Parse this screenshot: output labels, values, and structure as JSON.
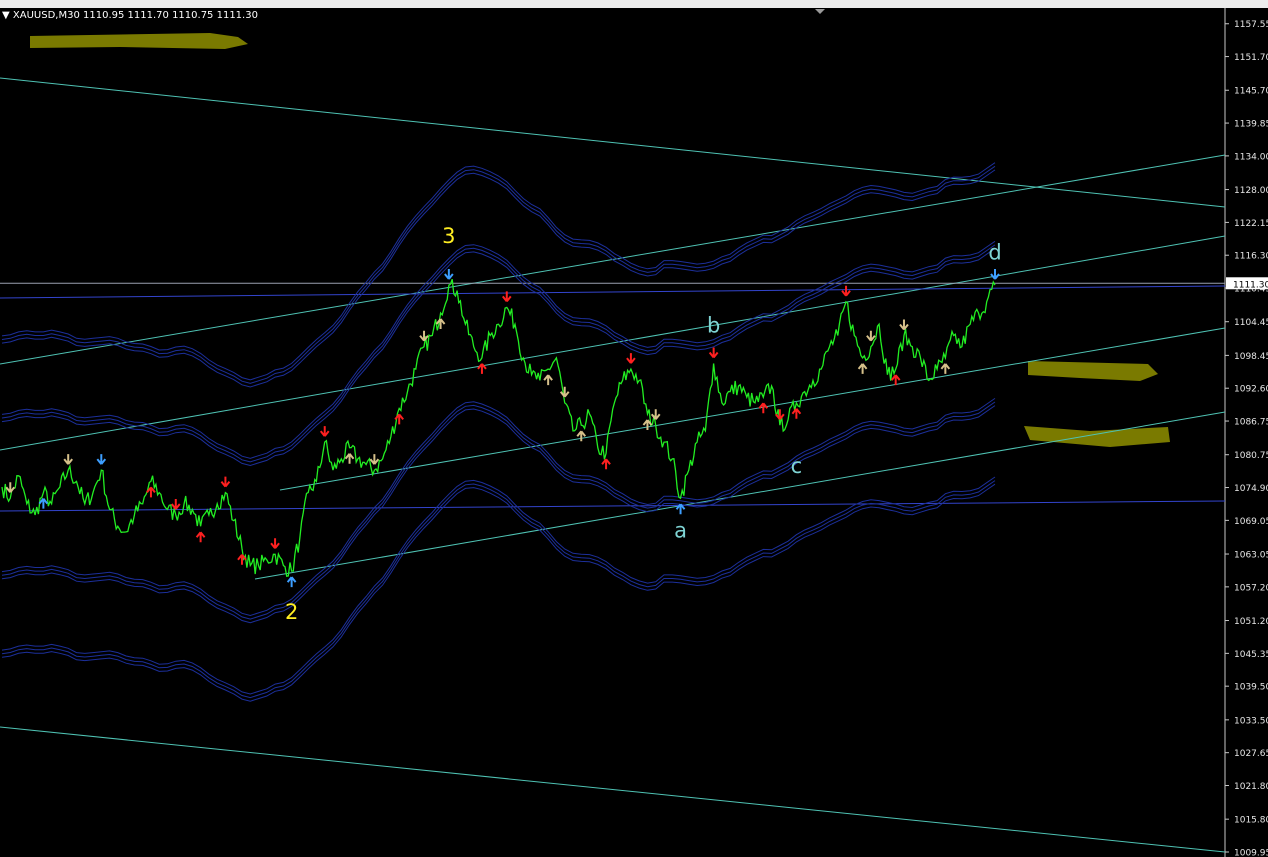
{
  "header": {
    "symbol": "XAUUSD,M30",
    "quote": "1110.95 1111.70 1110.75 1111.30"
  },
  "colors": {
    "background": "#000000",
    "price": "#22ee22",
    "band": "#1c2f9a",
    "channel": "#4fc3b4",
    "horizontal": "#3344cc",
    "arrow_up_blue": "#3d9eff",
    "arrow_down_red": "#ff2020",
    "arrow_beige": "#d6c08a",
    "wave_yellow": "#ffee22",
    "wave_cyan": "#7fd4d4",
    "highlight": "#7a7a00"
  },
  "chart_data": {
    "type": "line",
    "title": "",
    "ylim": [
      1009.95,
      1160.0
    ],
    "y_ticks": [
      "1157.55",
      "1151.70",
      "1145.70",
      "1139.85",
      "1134.00",
      "1128.00",
      "1122.15",
      "1116.30",
      "1110.45",
      "1104.45",
      "1098.45",
      "1092.60",
      "1086.75",
      "1080.75",
      "1074.90",
      "1069.05",
      "1063.05",
      "1057.20",
      "1051.20",
      "1045.35",
      "1039.50",
      "1033.50",
      "1027.65",
      "1021.80",
      "1015.80",
      "1009.95"
    ],
    "current_price": "1111.30",
    "series": [
      {
        "values": [
          1075,
          1073,
          1077,
          1072,
          1070,
          1074,
          1072,
          1075,
          1078,
          1076,
          1072,
          1074,
          1078,
          1071,
          1068,
          1067,
          1070,
          1072,
          1076,
          1074,
          1071,
          1070,
          1072,
          1071,
          1068,
          1070,
          1072,
          1074,
          1069,
          1064,
          1061,
          1061,
          1062,
          1063,
          1061,
          1060,
          1066,
          1074,
          1076,
          1083,
          1078,
          1080,
          1082,
          1080,
          1079,
          1078,
          1080,
          1084,
          1089,
          1092,
          1096,
          1100,
          1102,
          1106,
          1111,
          1110,
          1104,
          1100,
          1098,
          1102,
          1104,
          1107,
          1104,
          1098,
          1095,
          1094,
          1096,
          1098,
          1090,
          1085,
          1086,
          1088,
          1082,
          1081,
          1090,
          1094,
          1096,
          1094,
          1088,
          1086,
          1083,
          1080,
          1073,
          1078,
          1083,
          1085,
          1097,
          1090,
          1092,
          1093,
          1091,
          1090,
          1091,
          1093,
          1086,
          1087,
          1090,
          1092,
          1094,
          1096,
          1100,
          1102,
          1108,
          1102,
          1098,
          1100,
          1104,
          1095,
          1096,
          1102,
          1100,
          1098,
          1094,
          1096,
          1098,
          1102,
          1100,
          1104,
          1106,
          1108,
          1111
        ]
      }
    ],
    "wave_labels": [
      {
        "text": "2",
        "series_index": 35,
        "price": 1051.5
      },
      {
        "text": "3",
        "series_index": 54,
        "price": 1118.5
      },
      {
        "text": "a",
        "series_index": 82,
        "price": 1066.0
      },
      {
        "text": "b",
        "series_index": 86,
        "price": 1102.5
      },
      {
        "text": "c",
        "series_index": 96,
        "price": 1077.5
      },
      {
        "text": "d",
        "series_index": 120,
        "price": 1115.5
      }
    ],
    "arrows": [
      {
        "i": 5,
        "dir": "up",
        "color": "blue"
      },
      {
        "i": 12,
        "dir": "down",
        "color": "blue"
      },
      {
        "i": 8,
        "dir": "down",
        "color": "beige"
      },
      {
        "i": 1,
        "dir": "down",
        "color": "beige"
      },
      {
        "i": 18,
        "dir": "up",
        "color": "red"
      },
      {
        "i": 21,
        "dir": "down",
        "color": "red"
      },
      {
        "i": 24,
        "dir": "up",
        "color": "red"
      },
      {
        "i": 27,
        "dir": "down",
        "color": "red"
      },
      {
        "i": 29,
        "dir": "up",
        "color": "red"
      },
      {
        "i": 33,
        "dir": "down",
        "color": "red"
      },
      {
        "i": 35,
        "dir": "up",
        "color": "blue"
      },
      {
        "i": 39,
        "dir": "down",
        "color": "red"
      },
      {
        "i": 42,
        "dir": "up",
        "color": "beige"
      },
      {
        "i": 45,
        "dir": "down",
        "color": "beige"
      },
      {
        "i": 48,
        "dir": "up",
        "color": "red"
      },
      {
        "i": 51,
        "dir": "down",
        "color": "beige"
      },
      {
        "i": 53,
        "dir": "up",
        "color": "beige"
      },
      {
        "i": 54,
        "dir": "down",
        "color": "blue"
      },
      {
        "i": 58,
        "dir": "up",
        "color": "red"
      },
      {
        "i": 61,
        "dir": "down",
        "color": "red"
      },
      {
        "i": 66,
        "dir": "up",
        "color": "beige"
      },
      {
        "i": 68,
        "dir": "down",
        "color": "beige"
      },
      {
        "i": 70,
        "dir": "up",
        "color": "beige"
      },
      {
        "i": 73,
        "dir": "up",
        "color": "red"
      },
      {
        "i": 76,
        "dir": "down",
        "color": "red"
      },
      {
        "i": 78,
        "dir": "up",
        "color": "beige"
      },
      {
        "i": 79,
        "dir": "down",
        "color": "beige"
      },
      {
        "i": 82,
        "dir": "up",
        "color": "blue"
      },
      {
        "i": 86,
        "dir": "down",
        "color": "red"
      },
      {
        "i": 92,
        "dir": "up",
        "color": "red"
      },
      {
        "i": 94,
        "dir": "down",
        "color": "red"
      },
      {
        "i": 96,
        "dir": "up",
        "color": "red"
      },
      {
        "i": 102,
        "dir": "down",
        "color": "red"
      },
      {
        "i": 104,
        "dir": "up",
        "color": "beige"
      },
      {
        "i": 105,
        "dir": "down",
        "color": "beige"
      },
      {
        "i": 109,
        "dir": "down",
        "color": "beige"
      },
      {
        "i": 108,
        "dir": "up",
        "color": "red"
      },
      {
        "i": 114,
        "dir": "up",
        "color": "beige"
      },
      {
        "i": 120,
        "dir": "down",
        "color": "blue"
      }
    ],
    "horizontal_lines": [
      1111.3
    ],
    "grid": false
  }
}
